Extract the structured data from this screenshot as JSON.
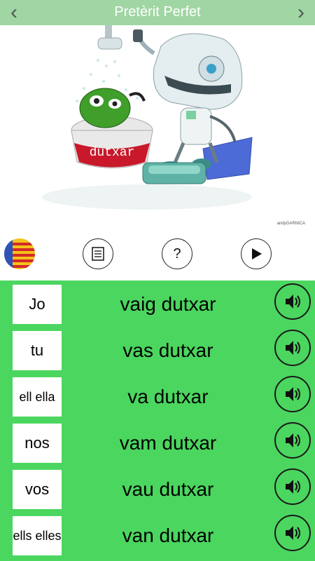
{
  "header": {
    "title": "Pretèrit Perfet"
  },
  "illustration": {
    "caption": "dutxar",
    "credit": "andyGARNICA"
  },
  "toolbar": {
    "flag_icon": "valencian-flag-icon",
    "notes_icon": "document-icon",
    "help_icon": "question-icon",
    "play_icon": "play-icon"
  },
  "conjugation": [
    {
      "pronoun": "Jo",
      "verb": "vaig dutxar"
    },
    {
      "pronoun": "tu",
      "verb": "vas dutxar"
    },
    {
      "pronoun": "ell ella",
      "verb": "va dutxar"
    },
    {
      "pronoun": "nos",
      "verb": "vam dutxar"
    },
    {
      "pronoun": "vos",
      "verb": "vau dutxar"
    },
    {
      "pronoun": "ells elles",
      "verb": "van dutxar"
    }
  ],
  "colors": {
    "panel": "#4bd65f",
    "topbar": "#9fd6a3"
  }
}
